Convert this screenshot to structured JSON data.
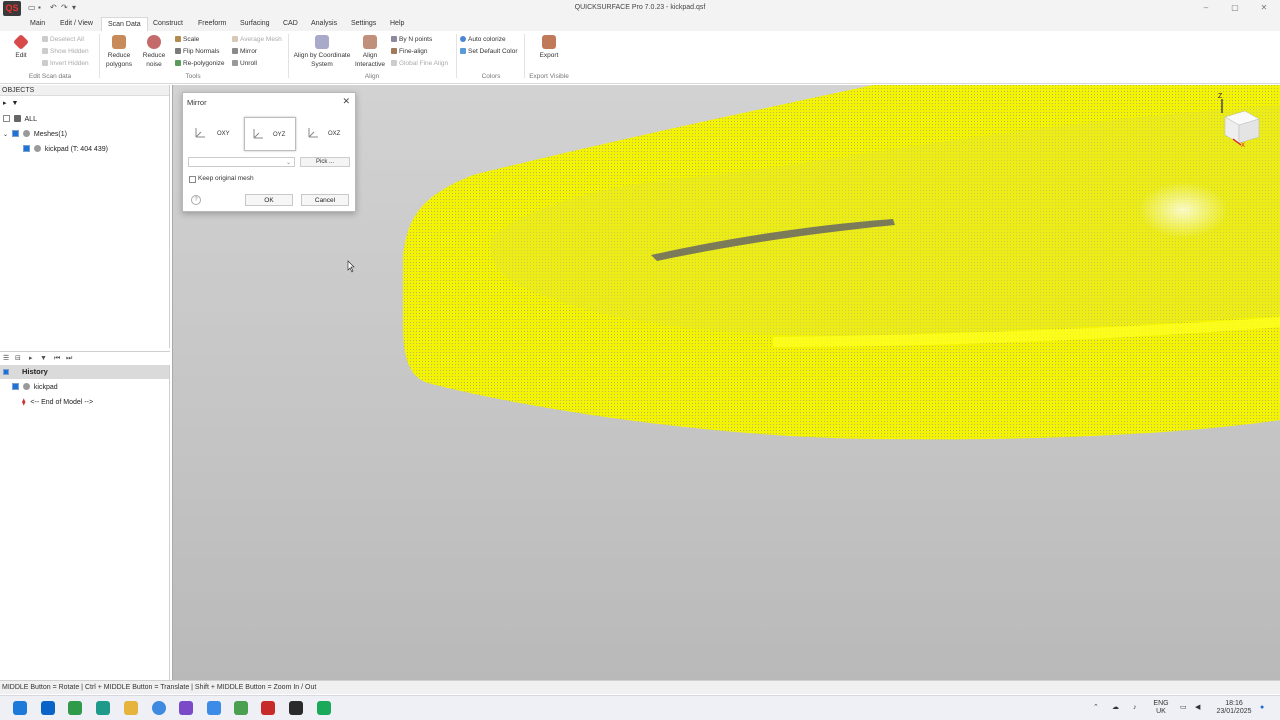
{
  "window": {
    "title": "QUICKSURFACE Pro 7.0.23 - kickpad.qsf",
    "logo": "QS"
  },
  "menu": {
    "tabs": [
      "Main",
      "Edit / View",
      "Scan Data",
      "Construct",
      "Freeform",
      "Surfacing",
      "CAD",
      "Analysis",
      "Settings",
      "Help"
    ],
    "active": "Scan Data"
  },
  "ribbon": {
    "edit": "Edit",
    "deselect_all": "Deselect All",
    "show_hidden": "Show Hidden",
    "invert_hidden": "Invert Hidden",
    "group_edit_scan": "Edit Scan data",
    "reduce_polygons": "Reduce polygons",
    "reduce_noise": "Reduce noise",
    "scale": "Scale",
    "flip_normals": "Flip Normals",
    "re_polygonize": "Re-polygonize",
    "average_mesh": "Average Mesh",
    "mirror": "Mirror",
    "unroll": "Unroll",
    "group_tools": "Tools",
    "align_by_cs": "Align by Coordinate System",
    "align_interactive": "Align Interactive",
    "by_n_points": "By N points",
    "fine_align": "Fine-align",
    "global_fine_align": "Global Fine Align",
    "group_align": "Align",
    "auto_colorize": "Auto colorize",
    "set_default_color": "Set Default Color",
    "group_colors": "Colors",
    "export": "Export",
    "group_export": "Export Visible"
  },
  "objects": {
    "header": "OBJECTS",
    "all": "ALL",
    "meshes": "Meshes(1)",
    "mesh_item": "kickpad (T: 404 439)"
  },
  "history": {
    "header": "History",
    "item": "kickpad",
    "end": "<-- End of Model -->"
  },
  "dialog": {
    "title": "Mirror",
    "planes": [
      "OXY",
      "OYZ",
      "OXZ"
    ],
    "selected_plane": "OYZ",
    "pick": "Pick ...",
    "keep_original": "Keep original mesh",
    "ok": "OK",
    "cancel": "Cancel",
    "help": "?"
  },
  "viewcube": {
    "z": "Z",
    "x": "X"
  },
  "statusbar": {
    "text": "MIDDLE Button = Rotate | Ctrl + MIDDLE Button = Translate | Shift + MIDDLE Button = Zoom In / Out"
  },
  "taskbar": {
    "lang": "ENG",
    "region": "UK",
    "time": "18:16",
    "date": "23/01/2025"
  },
  "colors": {
    "mesh": "#f2f200",
    "accent": "#1f73d6",
    "viewport_top": "#d2d2d2"
  }
}
